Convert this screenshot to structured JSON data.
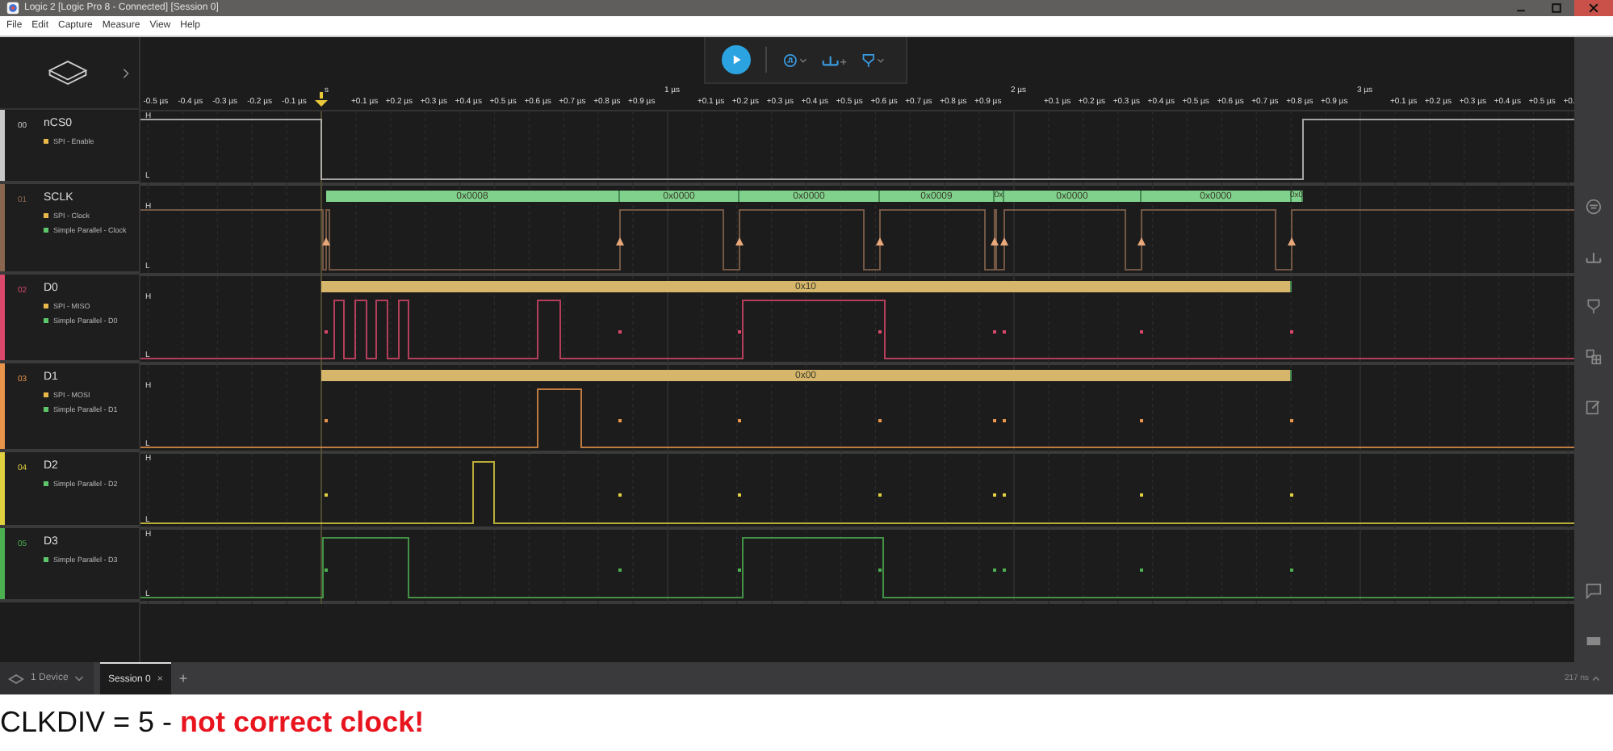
{
  "window": {
    "title": "Logic 2 [Logic Pro 8 - Connected] [Session 0]"
  },
  "menu": [
    "File",
    "Edit",
    "Capture",
    "Measure",
    "View",
    "Help"
  ],
  "ruler": {
    "cursor_label": "s",
    "major": [
      "1 µs",
      "2 µs",
      "3 µs"
    ],
    "minor": [
      "-0.5 µs",
      "-0.4 µs",
      "-0.3 µs",
      "-0.2 µs",
      "-0.1 µs",
      "+0.1 µs",
      "+0.2 µs",
      "+0.3 µs",
      "+0.4 µs",
      "+0.5 µs",
      "+0.6 µs",
      "+0.7 µs",
      "+0.8 µs",
      "+0.9 µs",
      "+0.1 µs",
      "+0.2 µs",
      "+0.3 µs",
      "+0.4 µs",
      "+0.5 µs",
      "+0.6 µs",
      "+0.7 µs",
      "+0.8 µs",
      "+0.9 µs",
      "+0.1 µs",
      "+0.2 µs",
      "+0.3 µs",
      "+0.4 µs",
      "+0.5 µs",
      "+0.6 µs",
      "+0.7 µs",
      "+0.8 µs",
      "+0.9 µs",
      "+0.1 µs",
      "+0.2 µs",
      "+0.3 µs",
      "+0.4 µs",
      "+0.5 µs",
      "+0."
    ]
  },
  "channels": [
    {
      "number": "00",
      "name": "nCS0",
      "color": "#c8c8c8",
      "high_label": "H",
      "low_label": "L",
      "analyzers": [
        {
          "name": "SPI - Enable",
          "color": "#e8b84a"
        }
      ]
    },
    {
      "number": "01",
      "name": "SCLK",
      "color": "#8a6650",
      "high_label": "H",
      "low_label": "L",
      "analyzers": [
        {
          "name": "SPI - Clock",
          "color": "#e8b84a"
        },
        {
          "name": "Simple Parallel - Clock",
          "color": "#5cc76a"
        }
      ],
      "frames": {
        "color": "#7fd18c",
        "labels": [
          "0x0008",
          "0x0000",
          "0x0000",
          "0x0009",
          "0x",
          "0x0000",
          "0x0000",
          "0x0"
        ]
      }
    },
    {
      "number": "02",
      "name": "D0",
      "color": "#d9486a",
      "high_label": "H",
      "low_label": "L",
      "analyzers": [
        {
          "name": "SPI - MISO",
          "color": "#e8b84a"
        },
        {
          "name": "Simple Parallel - D0",
          "color": "#5cc76a"
        }
      ],
      "frames": {
        "color": "#d6b66a",
        "labels": [
          "0x10"
        ]
      }
    },
    {
      "number": "03",
      "name": "D1",
      "color": "#e8944a",
      "high_label": "H",
      "low_label": "L",
      "analyzers": [
        {
          "name": "SPI - MOSI",
          "color": "#e8b84a"
        },
        {
          "name": "Simple Parallel - D1",
          "color": "#5cc76a"
        }
      ],
      "frames": {
        "color": "#d6b66a",
        "labels": [
          "0x00"
        ]
      }
    },
    {
      "number": "04",
      "name": "D2",
      "color": "#e0d040",
      "high_label": "H",
      "low_label": "L",
      "analyzers": [
        {
          "name": "Simple Parallel - D2",
          "color": "#5cc76a"
        }
      ]
    },
    {
      "number": "05",
      "name": "D3",
      "color": "#4caf50",
      "high_label": "H",
      "low_label": "L",
      "analyzers": [
        {
          "name": "Simple Parallel - D3",
          "color": "#5cc76a"
        }
      ]
    }
  ],
  "bottom_bar": {
    "device_button": "1 Device",
    "tabs": [
      {
        "label": "Session 0",
        "selected": true,
        "close": "×"
      }
    ],
    "add_tab": "+",
    "zoom_readout": "217 ns"
  },
  "caption": "CLKDIV = 5 - **not correct clock!**"
}
